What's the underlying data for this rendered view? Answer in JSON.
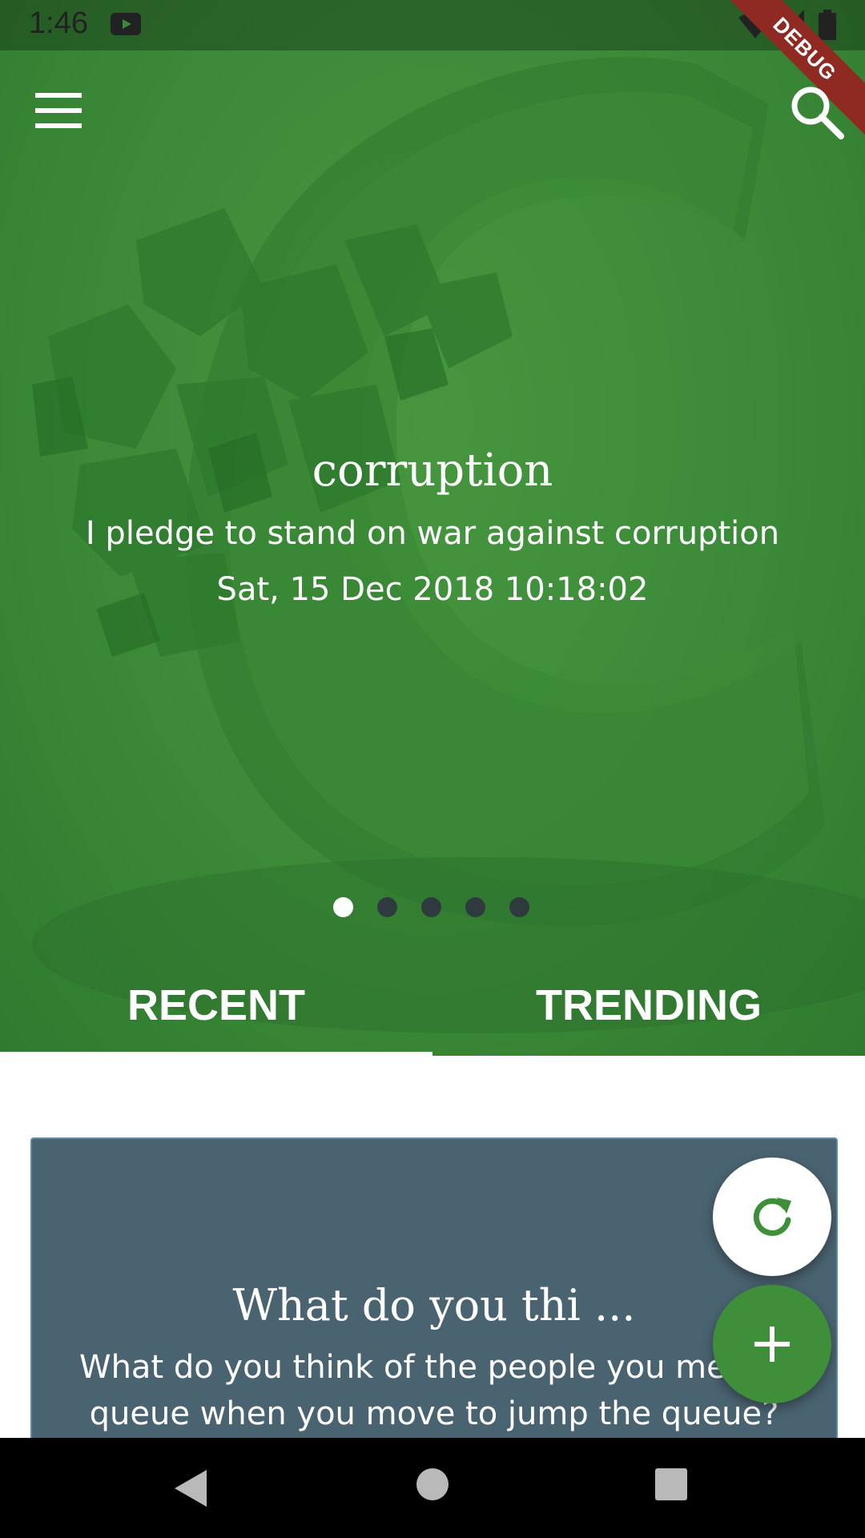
{
  "status_bar": {
    "time": "1:46",
    "debug_label": "DEBUG"
  },
  "app_bar": {
    "menu_icon": "hamburger-menu-icon",
    "search_icon": "search-icon"
  },
  "slide": {
    "title": "corruption",
    "description": "I pledge to stand on war against corruption",
    "date": "Sat, 15 Dec 2018 10:18:02",
    "page_count": 5,
    "active_page": 1
  },
  "tabs": [
    {
      "label": "RECENT",
      "selected": true
    },
    {
      "label": "TRENDING",
      "selected": false
    }
  ],
  "card": {
    "title": "What do you thi ...",
    "body": "What do you think of the people you met on queue when you move to jump the queue?"
  },
  "fabs": {
    "refresh_icon": "refresh-icon",
    "add_icon": "plus-icon"
  },
  "colors": {
    "primary": "#3f8f3a",
    "card_background": "#4a6370",
    "tab_indicator": "#ffffff"
  }
}
